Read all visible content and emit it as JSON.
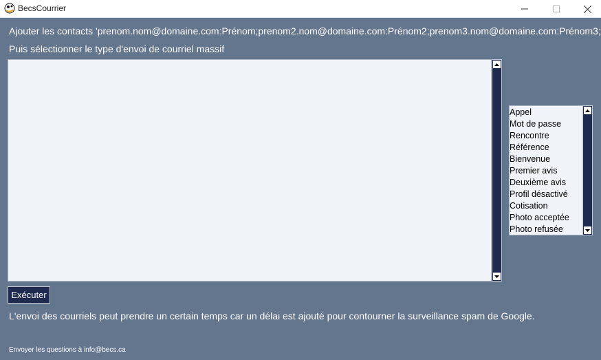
{
  "window": {
    "title": "BecsCourrier"
  },
  "instructions": {
    "line1": "Ajouter les contacts 'prenom.nom@domaine.com:Prénom;prenom2.nom@domaine.com:Prénom2;prenom3.nom@domaine.com:Prénom3;'",
    "line2": "Puis sélectionner le type d'envoi de courriel massif"
  },
  "contacts_input": {
    "value": ""
  },
  "mail_types": {
    "options": [
      "Appel",
      "Mot de passe",
      "Rencontre",
      "Référence",
      "Bienvenue",
      "Premier avis",
      "Deuxième avis",
      "Profil désactivé",
      "Cotisation",
      "Photo acceptée",
      "Photo refusée"
    ]
  },
  "actions": {
    "execute_label": "Exécuter"
  },
  "notes": {
    "delay": "L'envoi des courriels peut prendre un certain temps car un délai est ajouté pour contourner la surveillance spam de Google.",
    "contact": "Envoyer les questions à info@becs.ca"
  },
  "colors": {
    "background": "#64758e",
    "button": "#1e2a4e",
    "field": "#f0f3f8"
  }
}
